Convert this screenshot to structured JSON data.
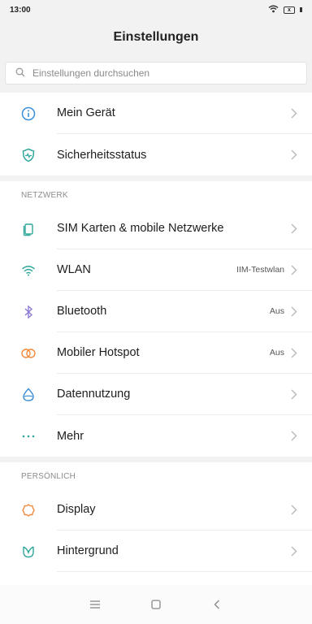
{
  "status_bar": {
    "time": "13:00",
    "battery": "x"
  },
  "header": {
    "title": "Einstellungen"
  },
  "search": {
    "placeholder": "Einstellungen durchsuchen"
  },
  "top_items": [
    {
      "label": "Mein Gerät",
      "icon": "info-icon"
    },
    {
      "label": "Sicherheitsstatus",
      "icon": "shield-icon"
    }
  ],
  "sections": {
    "network": {
      "header": "NETZWERK",
      "items": [
        {
          "label": "SIM Karten & mobile Netzwerke",
          "value": "",
          "icon": "sim-card-icon"
        },
        {
          "label": "WLAN",
          "value": "IIM-Testwlan",
          "icon": "wifi-icon"
        },
        {
          "label": "Bluetooth",
          "value": "Aus",
          "icon": "bluetooth-icon"
        },
        {
          "label": "Mobiler Hotspot",
          "value": "Aus",
          "icon": "hotspot-icon"
        },
        {
          "label": "Datennutzung",
          "value": "",
          "icon": "data-usage-icon"
        },
        {
          "label": "Mehr",
          "value": "",
          "icon": "more-icon"
        }
      ]
    },
    "personal": {
      "header": "PERSÖNLICH",
      "items": [
        {
          "label": "Display",
          "value": "",
          "icon": "display-icon"
        },
        {
          "label": "Hintergrund",
          "value": "",
          "icon": "wallpaper-icon"
        }
      ]
    }
  },
  "colors": {
    "accent_teal": "#2fa79a",
    "accent_blue": "#3c8fd6",
    "accent_purple": "#8d7ad6",
    "accent_orange": "#f08a3c",
    "chevron": "#b8b8b8"
  },
  "nav_bar": {
    "menu_icon": "menu-icon",
    "home_icon": "home-icon",
    "back_icon": "back-icon"
  }
}
